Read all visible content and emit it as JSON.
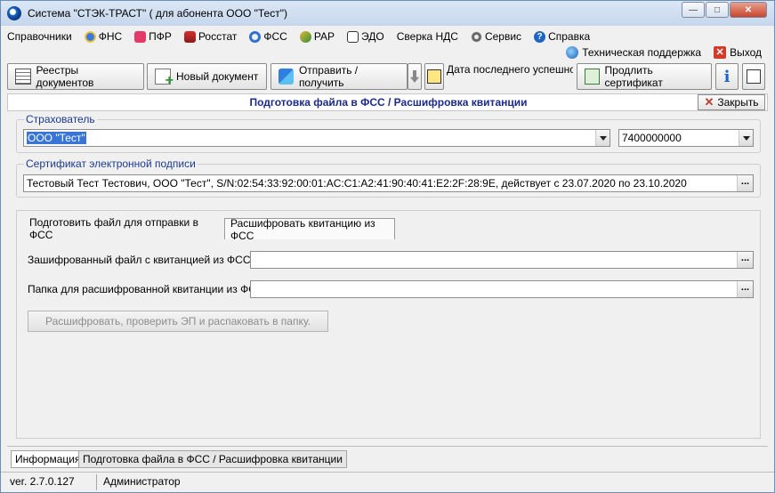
{
  "window": {
    "title": "Система \"СТЭК-ТРАСТ\" ( для абонента ООО \"Тест\")",
    "controls": {
      "minimize": "—",
      "maximize": "□",
      "close": "✕"
    }
  },
  "menu": {
    "items": [
      {
        "label": "Справочники",
        "icon": ""
      },
      {
        "label": "ФНС",
        "icon": "fns-icon"
      },
      {
        "label": "ПФР",
        "icon": "pfr-icon"
      },
      {
        "label": "Росстат",
        "icon": "rosstat-icon"
      },
      {
        "label": "ФСС",
        "icon": "fss-icon"
      },
      {
        "label": "РАР",
        "icon": "rar-icon"
      },
      {
        "label": "ЭДО",
        "icon": "edo-icon"
      },
      {
        "label": "Сверка НДС",
        "icon": ""
      },
      {
        "label": "Сервис",
        "icon": "gear-icon"
      },
      {
        "label": "Справка",
        "icon": "help-icon"
      }
    ],
    "support": "Техническая поддержка",
    "exit": "Выход"
  },
  "toolbar": {
    "registry": "Реестры документов",
    "new_doc": "Новый документ",
    "send_receive": "Отправить / получить",
    "last_date": "Дата последнего успешного",
    "extend_cert": "Продлить сертификат",
    "info_symbol": "i"
  },
  "document": {
    "title": "Подготовка файла в ФСС / Расшифровка квитанции",
    "close": "Закрыть"
  },
  "insurer": {
    "label": "Страхователь",
    "name": "ООО \"Тест\"",
    "code": "7400000000"
  },
  "certificate": {
    "label": "Сертификат электронной подписи",
    "value": "Тестовый Тест Тестович, ООО \"Тест\", S/N:02:54:33:92:00:01:AC:C1:A2:41:90:40:41:E2:2F:28:9E, действует с 23.07.2020 по 23.10.2020"
  },
  "tabs": {
    "prepare": "Подготовить файл для отправки в ФСС",
    "decrypt": "Расшифровать квитанцию из ФСС",
    "active": "decrypt"
  },
  "decrypt_form": {
    "encrypted_label": "Зашифрованный файл с квитанцией из ФСС",
    "encrypted_value": "",
    "folder_label": "Папка для расшифрованной квитанции из ФСС",
    "folder_value": "",
    "action": "Расшифровать, проверить ЭП и распаковать в папку.",
    "browse": "..."
  },
  "bottom_tabs": {
    "info": "Информация",
    "current": "Подготовка файла в ФСС / Расшифровка квитанции"
  },
  "status": {
    "version": "ver. 2.7.0.127",
    "user": "Администратор"
  }
}
